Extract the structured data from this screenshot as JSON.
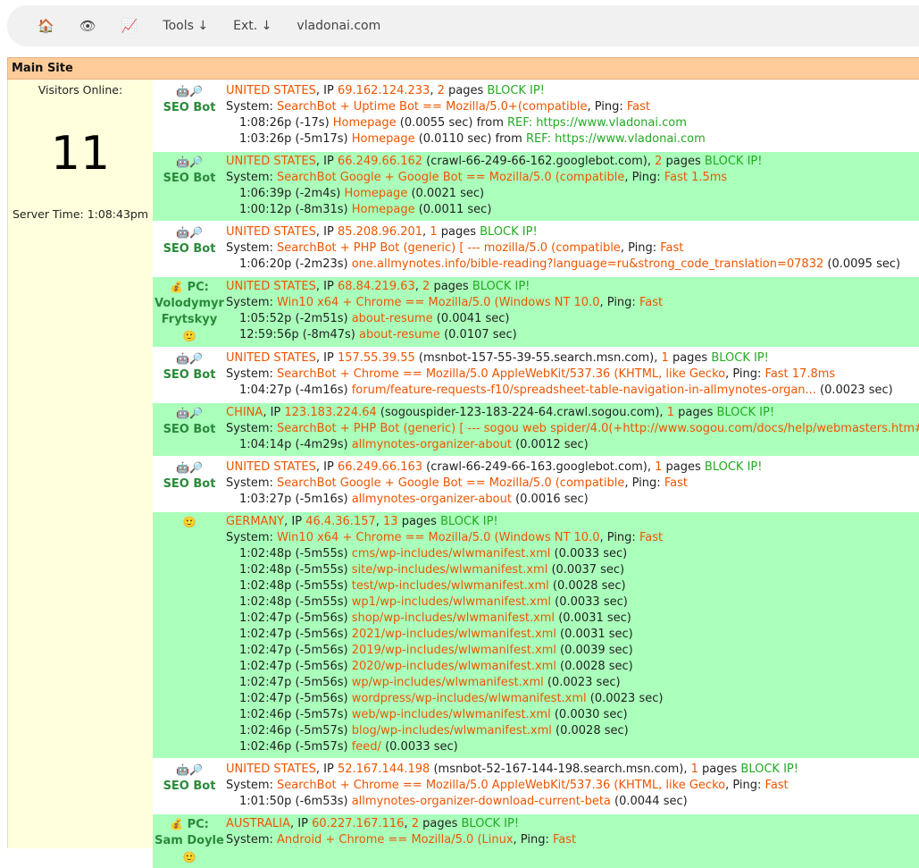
{
  "nav": {
    "home_icon": "🏠",
    "eye_icon": "👁",
    "chart_icon": "📈",
    "tools": "Tools ↓",
    "ext": "Ext. ↓",
    "site": "vladonai.com"
  },
  "section_title": "Main Site",
  "left": {
    "visitors_label": "Visitors Online:",
    "visitors_count": "11",
    "server_time": "Server Time: 1:08:43pm"
  },
  "icons": {
    "robot": "🤖",
    "magnifier": "🔎",
    "money": "💰",
    "face": "🙂"
  },
  "labels": {
    "ip": ", IP ",
    "block": "BLOCK IP!",
    "system": "System: ",
    "ping": ", Ping: ",
    "from": " from ",
    "ref": "REF: "
  },
  "visits": [
    {
      "bg": "white",
      "kind": "bot",
      "label": "SEO Bot",
      "country": "UNITED STATES",
      "ip": "69.162.124.233",
      "host": "",
      "pages_num": "2",
      "pages_word": " pages ",
      "system": "SearchBot + Uptime Bot == Mozilla/5.0+(compatible",
      "ping": "Fast",
      "hits": [
        {
          "time": "1:08:26p (-17s) ",
          "page": "Homepage",
          "dur": " (0.0055 sec)",
          "ref": "https://www.vladonai.com"
        },
        {
          "time": "1:03:26p (-5m17s) ",
          "page": "Homepage",
          "dur": " (0.0110 sec)",
          "ref": "https://www.vladonai.com"
        }
      ]
    },
    {
      "bg": "green",
      "kind": "bot",
      "label": "SEO Bot",
      "country": "UNITED STATES",
      "ip": "66.249.66.162",
      "host": " (crawl-66-249-66-162.googlebot.com)",
      "pages_num": "2",
      "pages_word": " pages ",
      "system": "SearchBot Google + Google Bot == Mozilla/5.0 (compatible",
      "ping": "Fast 1.5ms",
      "hits": [
        {
          "time": "1:06:39p (-2m4s) ",
          "page": "Homepage",
          "dur": " (0.0021 sec)",
          "ref": ""
        },
        {
          "time": "1:00:12p (-8m31s) ",
          "page": "Homepage",
          "dur": " (0.0011 sec)",
          "ref": ""
        }
      ]
    },
    {
      "bg": "white",
      "kind": "bot",
      "label": "SEO Bot",
      "country": "UNITED STATES",
      "ip": "85.208.96.201",
      "host": "",
      "pages_num": "1",
      "pages_word": " pages ",
      "system": "SearchBot + PHP Bot (generic) [ --- mozilla/5.0 (compatible",
      "ping": "Fast",
      "hits": [
        {
          "time": "1:06:20p (-2m23s) ",
          "page": "one.allmynotes.info/bible-reading?language=ru&strong_code_translation=07832",
          "dur": " (0.0095 sec)",
          "ref": ""
        }
      ]
    },
    {
      "bg": "green",
      "kind": "pc",
      "label": "PC:",
      "name": "Volodymyr Frytskyy",
      "country": "UNITED STATES",
      "ip": "68.84.219.63",
      "host": "",
      "pages_num": "2",
      "pages_word": " pages ",
      "system": "Win10 x64 + Chrome == Mozilla/5.0 (Windows NT 10.0",
      "ping": "Fast",
      "hits": [
        {
          "time": "1:05:52p (-2m51s) ",
          "page": "about-resume",
          "dur": " (0.0041 sec)",
          "ref": ""
        },
        {
          "time": "12:59:56p (-8m47s) ",
          "page": "about-resume",
          "dur": " (0.0107 sec)",
          "ref": ""
        }
      ]
    },
    {
      "bg": "white",
      "kind": "bot",
      "label": "SEO Bot",
      "country": "UNITED STATES",
      "ip": "157.55.39.55",
      "host": " (msnbot-157-55-39-55.search.msn.com)",
      "pages_num": "1",
      "pages_word": " pages ",
      "system": "SearchBot + Chrome == Mozilla/5.0 AppleWebKit/537.36 (KHTML, like Gecko",
      "ping": "Fast 17.8ms",
      "hits": [
        {
          "time": "1:04:27p (-4m16s) ",
          "page": "forum/feature-requests-f10/spreadsheet-table-navigation-in-allmynotes-organ...",
          "dur": " (0.0023 sec)",
          "ref": ""
        }
      ]
    },
    {
      "bg": "green",
      "kind": "bot",
      "label": "SEO Bot",
      "country": "CHINA",
      "ip": "123.183.224.64",
      "host": " (sogouspider-123-183-224-64.crawl.sogou.com)",
      "pages_num": "1",
      "pages_word": " pages ",
      "system": "SearchBot + PHP Bot (generic) [ --- sogou web spider/4.0(+http://www.sogou.com/docs/help/webmasters.htm#07",
      "ping": "",
      "hits": [
        {
          "time": "1:04:14p (-4m29s) ",
          "page": "allmynotes-organizer-about",
          "dur": " (0.0012 sec)",
          "ref": ""
        }
      ]
    },
    {
      "bg": "white",
      "kind": "bot",
      "label": "SEO Bot",
      "country": "UNITED STATES",
      "ip": "66.249.66.163",
      "host": " (crawl-66-249-66-163.googlebot.com)",
      "pages_num": "1",
      "pages_word": " pages ",
      "system": "SearchBot Google + Google Bot == Mozilla/5.0 (compatible",
      "ping": "Fast",
      "hits": [
        {
          "time": "1:03:27p (-5m16s) ",
          "page": "allmynotes-organizer-about",
          "dur": " (0.0016 sec)",
          "ref": ""
        }
      ]
    },
    {
      "bg": "green",
      "kind": "human",
      "label": "",
      "country": "GERMANY",
      "ip": "46.4.36.157",
      "host": "",
      "pages_num": "13",
      "pages_word": " pages ",
      "system": "Win10 x64 + Chrome == Mozilla/5.0 (Windows NT 10.0",
      "ping": "Fast",
      "hits": [
        {
          "time": "1:02:48p (-5m55s) ",
          "page": "cms/wp-includes/wlwmanifest.xml",
          "dur": " (0.0033 sec)",
          "ref": ""
        },
        {
          "time": "1:02:48p (-5m55s) ",
          "page": "site/wp-includes/wlwmanifest.xml",
          "dur": " (0.0037 sec)",
          "ref": ""
        },
        {
          "time": "1:02:48p (-5m55s) ",
          "page": "test/wp-includes/wlwmanifest.xml",
          "dur": " (0.0028 sec)",
          "ref": ""
        },
        {
          "time": "1:02:48p (-5m55s) ",
          "page": "wp1/wp-includes/wlwmanifest.xml",
          "dur": " (0.0033 sec)",
          "ref": ""
        },
        {
          "time": "1:02:47p (-5m56s) ",
          "page": "shop/wp-includes/wlwmanifest.xml",
          "dur": " (0.0031 sec)",
          "ref": ""
        },
        {
          "time": "1:02:47p (-5m56s) ",
          "page": "2021/wp-includes/wlwmanifest.xml",
          "dur": " (0.0031 sec)",
          "ref": ""
        },
        {
          "time": "1:02:47p (-5m56s) ",
          "page": "2019/wp-includes/wlwmanifest.xml",
          "dur": " (0.0039 sec)",
          "ref": ""
        },
        {
          "time": "1:02:47p (-5m56s) ",
          "page": "2020/wp-includes/wlwmanifest.xml",
          "dur": " (0.0028 sec)",
          "ref": ""
        },
        {
          "time": "1:02:47p (-5m56s) ",
          "page": "wp/wp-includes/wlwmanifest.xml",
          "dur": " (0.0023 sec)",
          "ref": ""
        },
        {
          "time": "1:02:47p (-5m56s) ",
          "page": "wordpress/wp-includes/wlwmanifest.xml",
          "dur": " (0.0023 sec)",
          "ref": ""
        },
        {
          "time": "1:02:46p (-5m57s) ",
          "page": "web/wp-includes/wlwmanifest.xml",
          "dur": " (0.0030 sec)",
          "ref": ""
        },
        {
          "time": "1:02:46p (-5m57s) ",
          "page": "blog/wp-includes/wlwmanifest.xml",
          "dur": " (0.0028 sec)",
          "ref": ""
        },
        {
          "time": "1:02:46p (-5m57s) ",
          "page": "feed/",
          "dur": " (0.0033 sec)",
          "ref": ""
        }
      ]
    },
    {
      "bg": "white",
      "kind": "bot",
      "label": "SEO Bot",
      "country": "UNITED STATES",
      "ip": "52.167.144.198",
      "host": " (msnbot-52-167-144-198.search.msn.com)",
      "pages_num": "1",
      "pages_word": " pages ",
      "system": "SearchBot + Chrome == Mozilla/5.0 AppleWebKit/537.36 (KHTML, like Gecko",
      "ping": "Fast",
      "hits": [
        {
          "time": "1:01:50p (-6m53s) ",
          "page": "allmynotes-organizer-download-current-beta",
          "dur": " (0.0044 sec)",
          "ref": ""
        }
      ]
    },
    {
      "bg": "green",
      "kind": "pc",
      "label": "PC:",
      "name": "Sam Doyle",
      "country": "AUSTRALIA",
      "ip": "60.227.167.116",
      "host": "",
      "pages_num": "2",
      "pages_word": " pages ",
      "system": "Android + Chrome == Mozilla/5.0 (Linux",
      "ping": "Fast",
      "hits": []
    }
  ]
}
